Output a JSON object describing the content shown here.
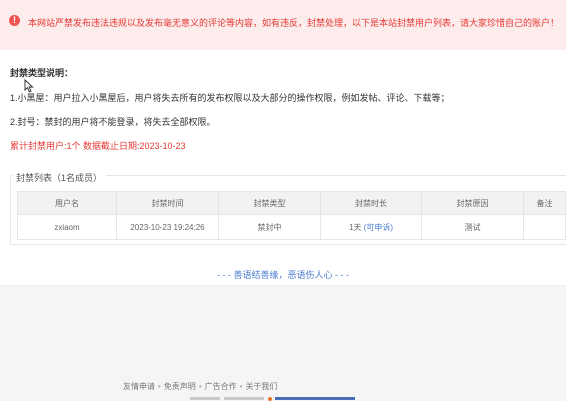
{
  "notice": {
    "icon": "alert-icon",
    "text": "本网站严禁发布违法违规以及发布毫无意义的评论等内容，如有违反，封禁处理，以下是本站封禁用户列表，请大家珍惜自己的账户！"
  },
  "explain": {
    "title": "封禁类型说明：",
    "line1": "1.小黑屋：用户拉入小黑屋后，用户将失去所有的发布权限以及大部分的操作权限，例如发帖、评论、下载等；",
    "line2": "2.封号：禁封的用户将不能登录，将失去全部权限。",
    "stats": "累计封禁用户:1个 数据截止日期:2023-10-23"
  },
  "banlist": {
    "legend": "封禁列表（1名成员）",
    "columns": [
      "用户名",
      "封禁时间",
      "封禁类型",
      "封禁时长",
      "封禁原因",
      "备注"
    ],
    "rows": [
      {
        "username": "zxiaom",
        "time": "2023-10-23 19:24:26",
        "type": "禁封中",
        "duration": "1天",
        "appeal": "(可申诉)",
        "reason": "测试",
        "note": ""
      }
    ]
  },
  "slogan": "- - - 善语结善缘，恶语伤人心 - - -",
  "footer": {
    "links": [
      "友情申请",
      "免责声明",
      "广告合作",
      "关于我们"
    ]
  },
  "colors": {
    "notice_bg": "#fdecec",
    "danger": "#e53935",
    "link": "#4a7bd0"
  }
}
